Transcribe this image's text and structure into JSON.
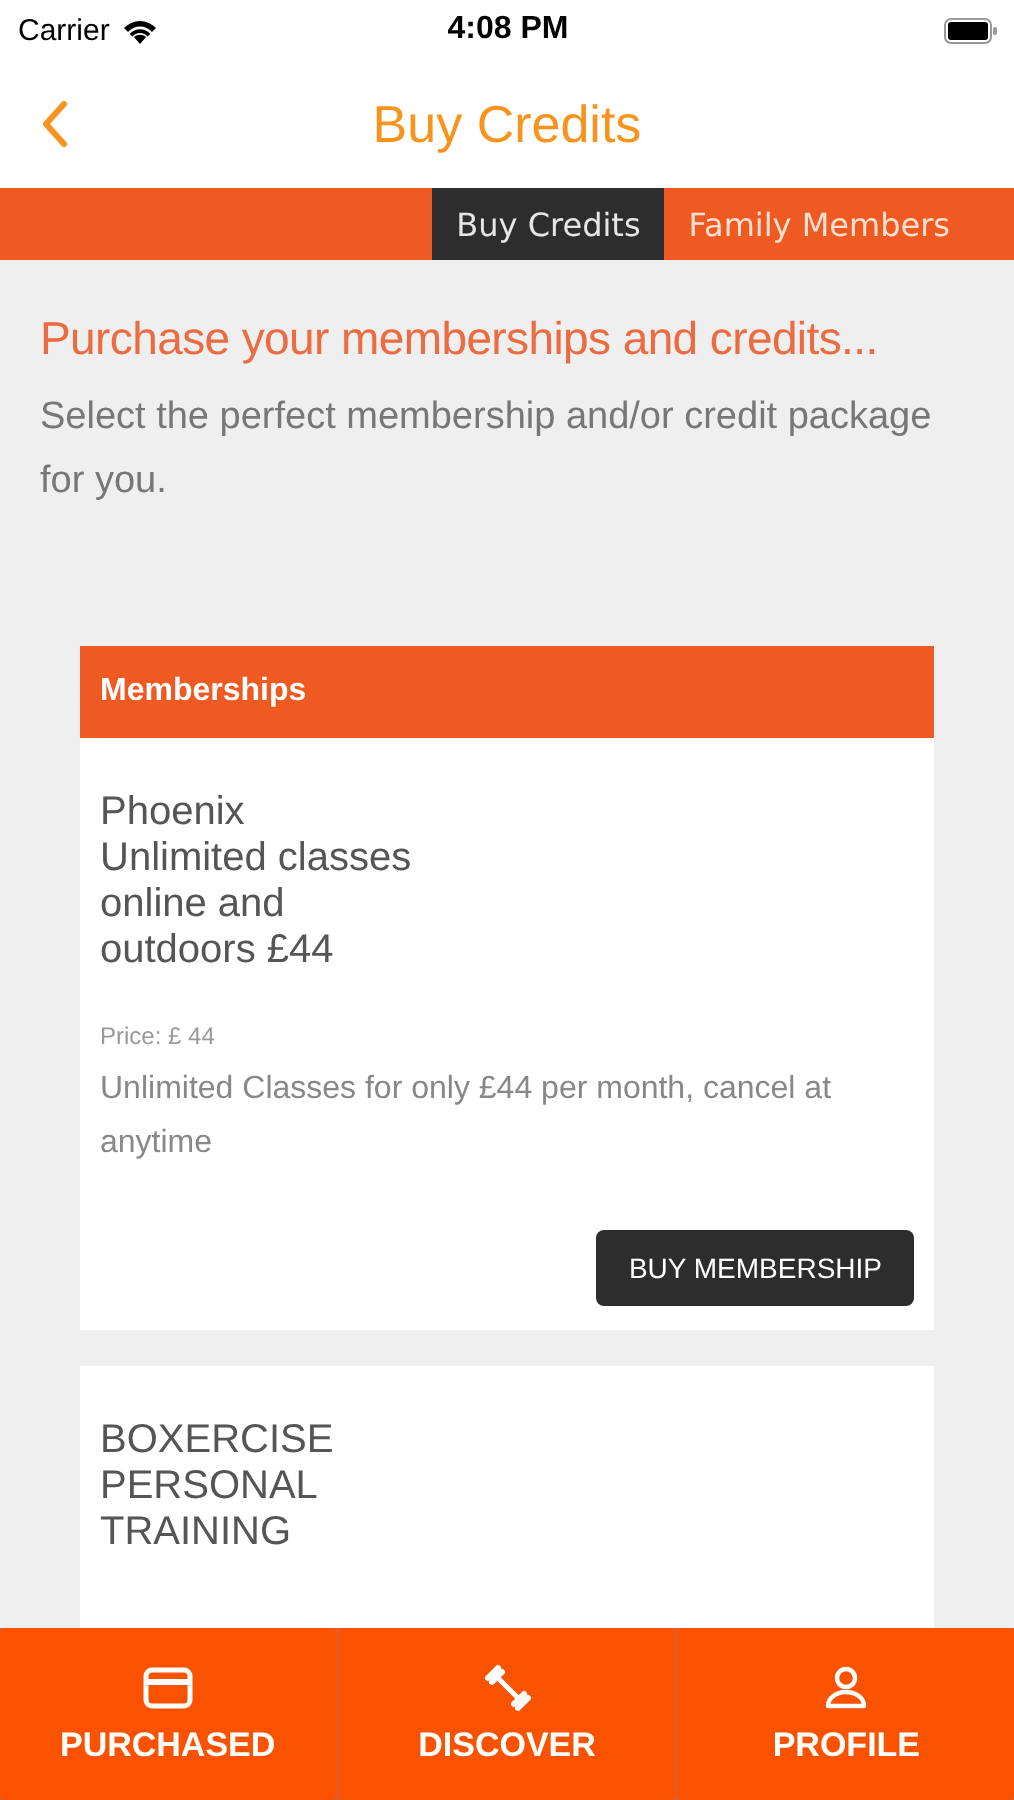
{
  "status_bar": {
    "carrier": "Carrier",
    "time": "4:08 PM"
  },
  "header": {
    "title": "Buy Credits"
  },
  "tabs": [
    {
      "label": "Buy Credits",
      "selected": true
    },
    {
      "label": "Family Members",
      "selected": false
    }
  ],
  "intro": {
    "heading": "Purchase your memberships and credits...",
    "text": "Select the perfect membership and/or credit package for you."
  },
  "section": {
    "title": "Memberships"
  },
  "packages": [
    {
      "title": "Phoenix\nUnlimited classes\nonline and\noutdoors £44",
      "price": "Price: £ 44",
      "description": "Unlimited Classes for only £44 per month, cancel at anytime",
      "button": "BUY MEMBERSHIP"
    },
    {
      "title": "BOXERCISE\nPERSONAL\nTRAINING"
    }
  ],
  "bottom_nav": [
    {
      "kind": "card",
      "label": "PURCHASED"
    },
    {
      "kind": "dumbbell",
      "label": "DISCOVER"
    },
    {
      "kind": "person",
      "label": "PROFILE"
    }
  ]
}
